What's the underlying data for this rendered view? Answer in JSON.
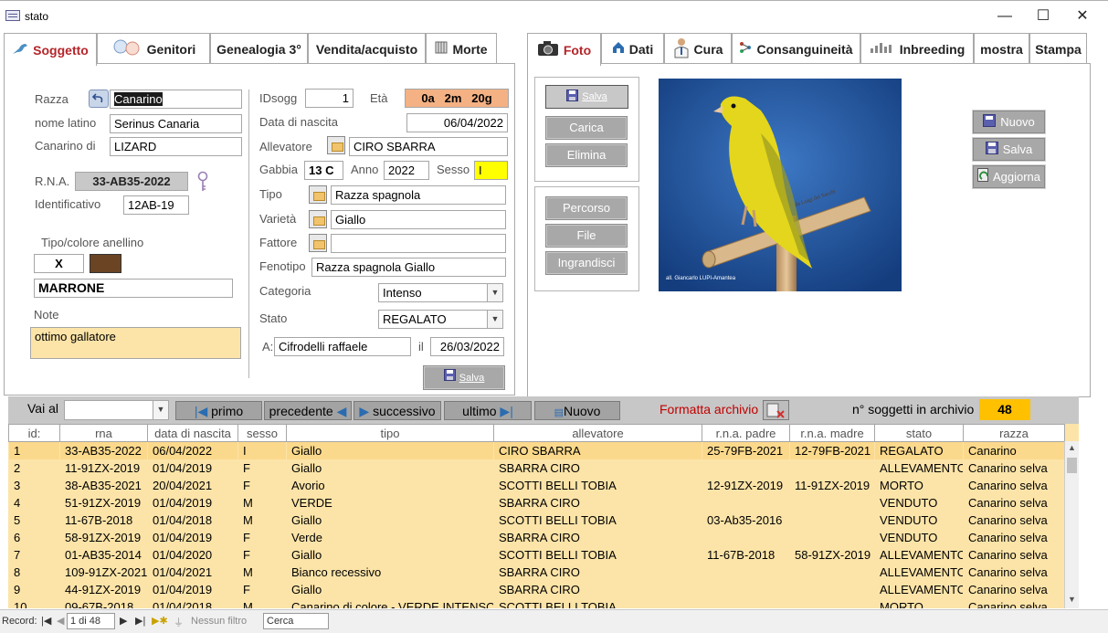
{
  "window": {
    "title": "stato",
    "minimize": "—",
    "maximize": "☐",
    "close": "✕"
  },
  "left_tabs": [
    {
      "label": "Soggetto",
      "icon": "bird-icon"
    },
    {
      "label": "Genitori",
      "icon": "parents-icon"
    },
    {
      "label": "Genealogia 3°"
    },
    {
      "label": "Vendita/acquisto"
    },
    {
      "label": "Morte",
      "icon": "ledger-icon"
    }
  ],
  "right_tabs": [
    {
      "label": "Foto",
      "icon": "camera-icon"
    },
    {
      "label": "Dati",
      "icon": "home-icon"
    },
    {
      "label": "Cura",
      "icon": "doctor-icon"
    },
    {
      "label": "Consanguineità",
      "icon": "tree-icon"
    },
    {
      "label": "Inbreeding",
      "icon": "chart-icon"
    },
    {
      "label": "mostra"
    },
    {
      "label": "Stampa"
    }
  ],
  "soggetto": {
    "razza_label": "Razza",
    "razza": "Canarino",
    "nome_latino_label": "nome latino",
    "nome_latino": "Serinus Canaria",
    "canarino_di_label": "Canarino di",
    "canarino_di": "LIZARD",
    "rna_label": "R.N.A.",
    "rna": "33-AB35-2022",
    "identificativo_label": "Identificativo",
    "identificativo": "12AB-19",
    "anellino_label": "Tipo/colore  anellino",
    "anellino_tipo": "X",
    "anellino_color": "#6b4423",
    "anellino_colore": "MARRONE",
    "note_label": "Note",
    "note": "ottimo gallatore",
    "idsogg_label": "IDsogg",
    "idsogg": "1",
    "eta_label": "Età",
    "eta": "0a   2m   20g",
    "data_nascita_label": "Data di nascita",
    "data_nascita": "06/04/2022",
    "allevatore_label": "Allevatore",
    "allevatore": "CIRO  SBARRA",
    "gabbia_label": "Gabbia",
    "gabbia": "13 C",
    "anno_label": "Anno",
    "anno": "2022",
    "sesso_label": "Sesso",
    "sesso": "I",
    "tipo_label": "Tipo",
    "tipo": "Razza spagnola",
    "varieta_label": "Varietà",
    "varieta": "Giallo",
    "fattore_label": "Fattore",
    "fattore": "",
    "fenotipo_label": "Fenotipo",
    "fenotipo": "Razza spagnola  Giallo",
    "categoria_label": "Categoria",
    "categoria": "Intenso",
    "stato_label": "Stato",
    "stato": "REGALATO",
    "a_label": "A:",
    "a": "Cifrodelli raffaele",
    "il_label": "il",
    "il": "26/03/2022",
    "salva": "Salva"
  },
  "foto": {
    "salva": "Salva",
    "carica": "Carica",
    "elimina": "Elimina",
    "percorso": "Percorso",
    "file": "File",
    "ingrandisci": "Ingrandisci",
    "photo_credit": "all. Giancarlo LUPI-Amantea",
    "perch_text": "da Luigi dei Sacchi"
  },
  "side_buttons": {
    "nuovo": "Nuovo",
    "salva": "Salva",
    "aggiorna": "Aggiorna"
  },
  "navbar": {
    "vai_al": "Vai al",
    "vai_value": "",
    "primo": "primo",
    "precedente": "precedente",
    "successivo": "successivo",
    "ultimo": "ultimo",
    "nuovo": "Nuovo",
    "formatta": "Formatta archivio",
    "count_label": "n° soggetti in archivio",
    "count": "48"
  },
  "table": {
    "columns": [
      "id:",
      "rna",
      "data di nascita",
      "sesso",
      "tipo",
      "allevatore",
      "r.n.a. padre",
      "r.n.a. madre",
      "stato",
      "razza"
    ],
    "rows": [
      [
        "1",
        "33-AB35-2022",
        "06/04/2022",
        "I",
        "Giallo",
        "CIRO  SBARRA",
        "25-79FB-2021",
        "12-79FB-2021",
        "REGALATO",
        "Canarino"
      ],
      [
        "2",
        "11-91ZX-2019",
        "01/04/2019",
        "F",
        "Giallo",
        "SBARRA  CIRO",
        "",
        "",
        "ALLEVAMENTO",
        "Canarino selva"
      ],
      [
        "3",
        "38-AB35-2021",
        "20/04/2021",
        "F",
        "Avorio",
        "SCOTTI BELLI  TOBIA",
        "12-91ZX-2019",
        "11-91ZX-2019",
        "MORTO",
        "Canarino selva"
      ],
      [
        "4",
        "51-91ZX-2019",
        "01/04/2019",
        "M",
        "VERDE",
        "SBARRA  CIRO",
        "",
        "",
        "VENDUTO",
        "Canarino selva"
      ],
      [
        "5",
        "11-67B-2018",
        "01/04/2018",
        "M",
        "Giallo",
        "SCOTTI BELLI  TOBIA",
        "03-Ab35-2016",
        "",
        "VENDUTO",
        "Canarino selva"
      ],
      [
        "6",
        "58-91ZX-2019",
        "01/04/2019",
        "F",
        "Verde",
        "SBARRA  CIRO",
        "",
        "",
        "VENDUTO",
        "Canarino selva"
      ],
      [
        "7",
        "01-AB35-2014",
        "01/04/2020",
        "F",
        "Giallo",
        "SCOTTI BELLI  TOBIA",
        "11-67B-2018",
        "58-91ZX-2019",
        "ALLEVAMENTO",
        "Canarino selva"
      ],
      [
        "8",
        "109-91ZX-2021",
        "01/04/2021",
        "M",
        "Bianco recessivo",
        "SBARRA  CIRO",
        "",
        "",
        "ALLEVAMENTO",
        "Canarino selva"
      ],
      [
        "9",
        "44-91ZX-2019",
        "01/04/2019",
        "F",
        "Giallo",
        "SBARRA  CIRO",
        "",
        "",
        "ALLEVAMENTO",
        "Canarino selva"
      ],
      [
        "10",
        "09-67B-2018",
        "01/04/2018",
        "M",
        "Canarino di colore - VERDE INTENSO",
        "SCOTTI BELLI  TOBIA",
        "",
        "",
        "MORTO",
        "Canarino selva"
      ]
    ]
  },
  "status": {
    "record_label": "Record:",
    "record": "1 di 48",
    "filter": "Nessun filtro",
    "search": "Cerca"
  }
}
